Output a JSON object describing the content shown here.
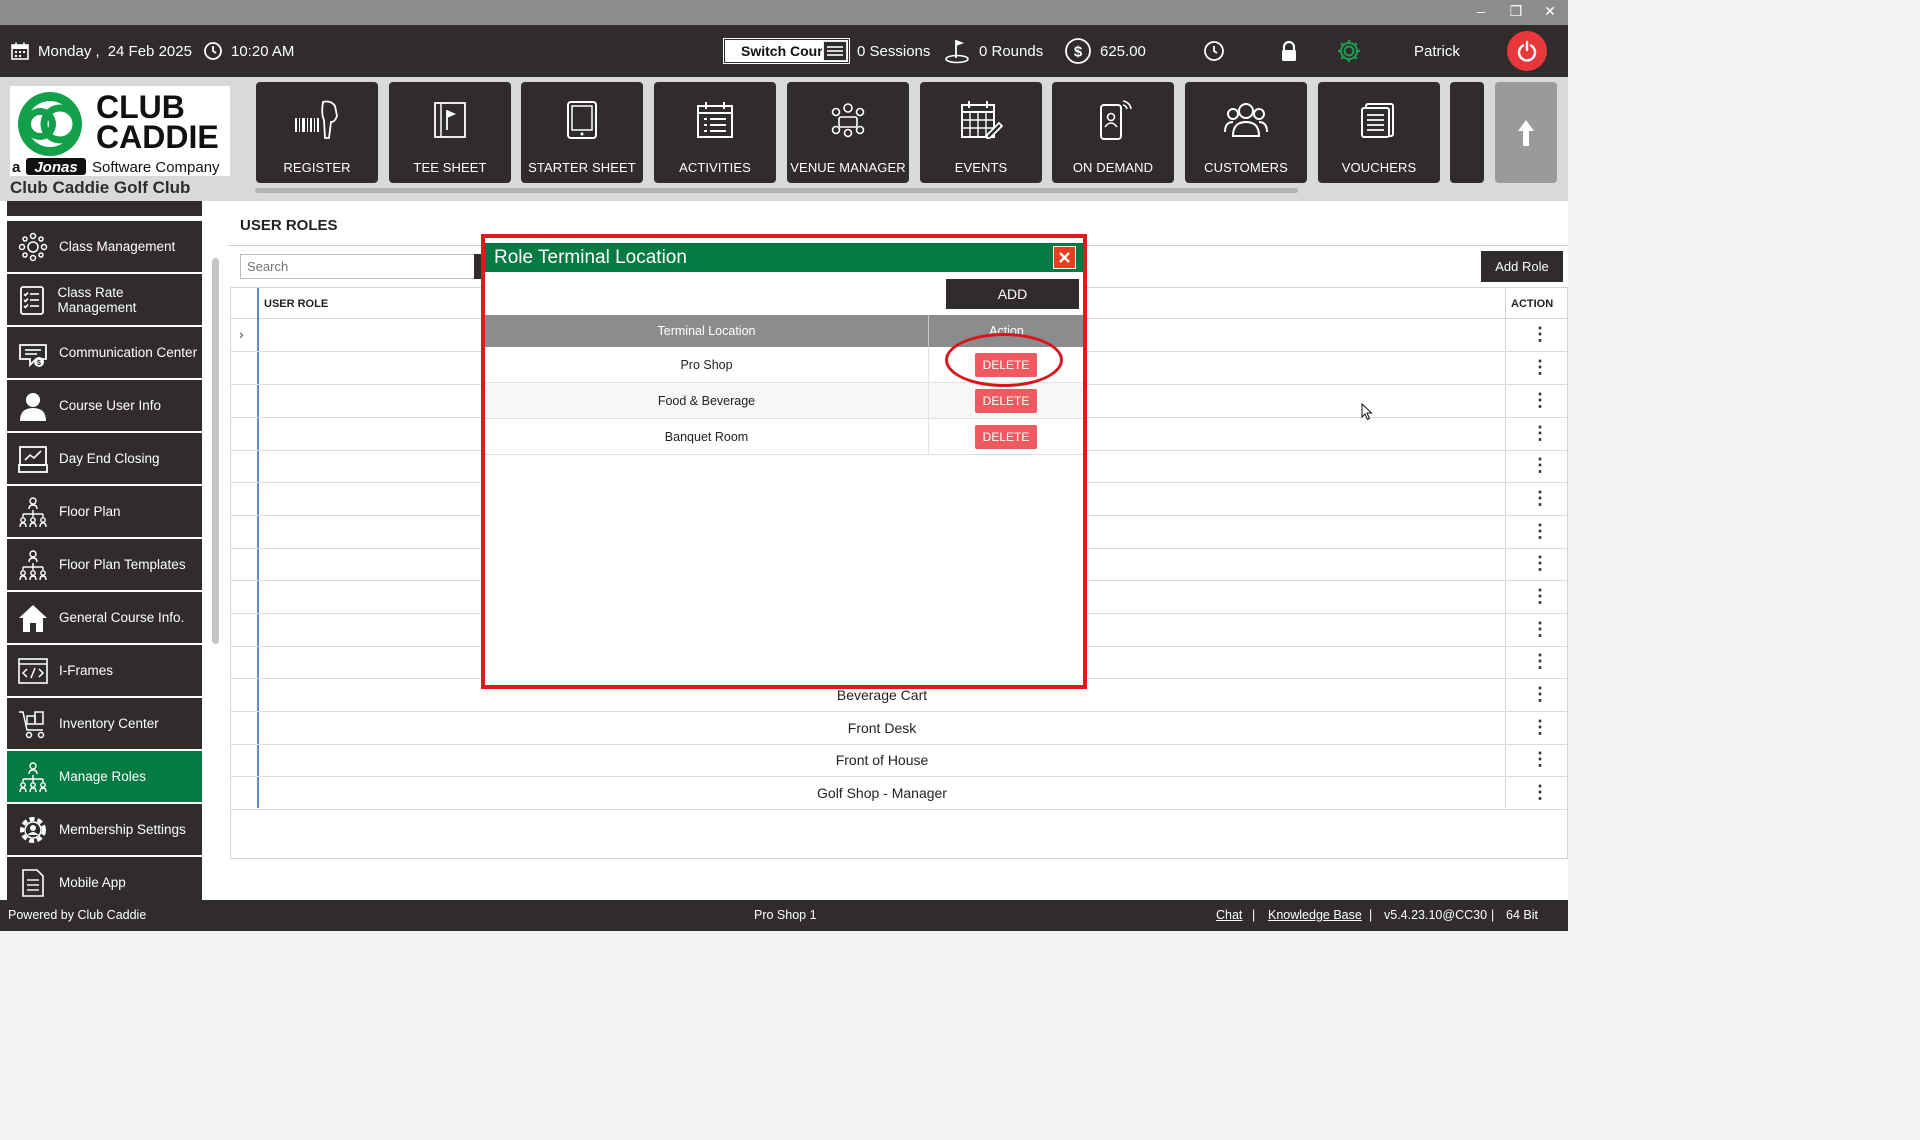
{
  "window": {
    "controls": [
      "–",
      "❐",
      "✕"
    ]
  },
  "topbar": {
    "date_day": "Monday ,",
    "date": "24 Feb 2025",
    "time": "10:20 AM",
    "switch_course_label": "Switch Course",
    "sessions": "0 Sessions",
    "rounds": "0 Rounds",
    "balance": "625.00",
    "user": "Patrick"
  },
  "logo": {
    "line1": "CLUB",
    "line2": "CADDIE",
    "tagline_a": "a",
    "tagline_brand": "Jonas",
    "tagline_rest": "Software Company",
    "club_name": "Club Caddie Golf Club"
  },
  "nav": [
    {
      "label": "REGISTER",
      "icon": "barcode-scanner-icon"
    },
    {
      "label": "TEE SHEET",
      "icon": "tee-sheet-icon"
    },
    {
      "label": "STARTER SHEET",
      "icon": "tablet-icon"
    },
    {
      "label": "ACTIVITIES",
      "icon": "calendar-list-icon"
    },
    {
      "label": "VENUE MANAGER",
      "icon": "meeting-icon"
    },
    {
      "label": "EVENTS",
      "icon": "calendar-edit-icon"
    },
    {
      "label": "ON DEMAND",
      "icon": "mobile-order-icon"
    },
    {
      "label": "CUSTOMERS",
      "icon": "users-icon"
    },
    {
      "label": "VOUCHERS",
      "icon": "voucher-icon"
    }
  ],
  "sidebar": {
    "items": [
      {
        "label": "Class Management"
      },
      {
        "label": "Class Rate Management"
      },
      {
        "label": "Communication Center"
      },
      {
        "label": "Course User Info"
      },
      {
        "label": "Day End Closing"
      },
      {
        "label": "Floor Plan"
      },
      {
        "label": "Floor Plan Templates"
      },
      {
        "label": "General Course Info."
      },
      {
        "label": "I-Frames"
      },
      {
        "label": "Inventory Center"
      },
      {
        "label": "Manage Roles"
      },
      {
        "label": "Membership Settings"
      },
      {
        "label": "Mobile App"
      }
    ],
    "active": "Manage Roles"
  },
  "main": {
    "title": "USER ROLES",
    "search_placeholder": "Search",
    "add_role_label": "Add Role",
    "col_role": "USER ROLE",
    "col_action": "ACTION",
    "rows": [
      "",
      "",
      "",
      "",
      "",
      "",
      "",
      "",
      "",
      "",
      "",
      "Beverage Cart",
      "Front Desk",
      "Front of House",
      "Golf Shop - Manager"
    ]
  },
  "modal": {
    "title": "Role Terminal Location",
    "add_label": "ADD",
    "col_location": "Terminal Location",
    "col_action": "Action",
    "rows": [
      {
        "location": "Pro Shop",
        "action": "DELETE"
      },
      {
        "location": "Food & Beverage",
        "action": "DELETE"
      },
      {
        "location": "Banquet Room",
        "action": "DELETE"
      }
    ]
  },
  "footer": {
    "powered": "Powered by Club Caddie",
    "terminal": "Pro Shop 1",
    "chat": "Chat",
    "sep": "|",
    "kb": "Knowledge Base",
    "version": "v5.4.23.10@CC30",
    "bits": "64 Bit"
  },
  "colors": {
    "brand_green": "#067a43",
    "dark": "#2f2c2b",
    "danger": "#ee5a5f",
    "annotation": "#e01a1a"
  }
}
